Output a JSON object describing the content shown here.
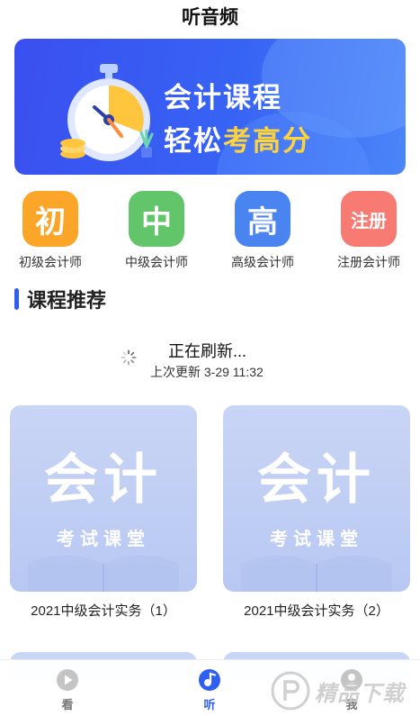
{
  "header": {
    "title": "听音频"
  },
  "banner": {
    "line1": "会计课程",
    "line2_white": "轻松",
    "line2_yellow": "考高分"
  },
  "categories": [
    {
      "glyph": "初",
      "label": "初级会计师",
      "color": "#fba628"
    },
    {
      "glyph": "中",
      "label": "中级会计师",
      "color": "#63c56a"
    },
    {
      "glyph": "高",
      "label": "高级会计师",
      "color": "#4a84f0"
    },
    {
      "glyph": "注册",
      "label": "注册会计师",
      "color": "#f77b72"
    }
  ],
  "section": {
    "title": "课程推荐"
  },
  "refresh": {
    "title": "正在刷新...",
    "time": "上次更新 3-29 11:32"
  },
  "courses": [
    {
      "thumb_big": "会计",
      "thumb_sub": "考试课堂",
      "title": "2021中级会计实务（1）"
    },
    {
      "thumb_big": "会计",
      "thumb_sub": "考试课堂",
      "title": "2021中级会计实务（2）"
    }
  ],
  "tabs": [
    {
      "label": "看",
      "icon": "play-circle-icon",
      "active": false
    },
    {
      "label": "听",
      "icon": "music-note-icon",
      "active": true
    },
    {
      "label": "我",
      "icon": "user-icon",
      "active": false
    }
  ],
  "watermark": {
    "text": "精品下载"
  },
  "colors": {
    "accent": "#2f5ff0",
    "tab_active": "#2f5ff0",
    "tab_inactive": "#b5b5b5"
  }
}
